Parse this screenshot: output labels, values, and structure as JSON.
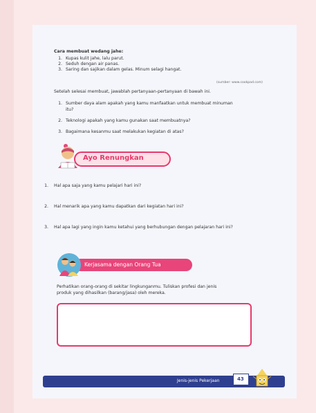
{
  "recipe": {
    "heading": "Cara membuat wedang jahe:",
    "steps": [
      {
        "num": "1.",
        "text": "Kupas kulit jahe, lalu parut."
      },
      {
        "num": "2.",
        "text": "Seduh dengan air panas."
      },
      {
        "num": "3.",
        "text": "Saring dan sajikan dalam gelas. Minum selagi hangat."
      }
    ],
    "source": "(sumber: www.cookpad.com)"
  },
  "questions": {
    "intro": "Setelah selesai membuat, jawablah pertanyaan-pertanyaan di bawah ini.",
    "items": [
      {
        "num": "1.",
        "line1": "Sumber daya alam apakah yang kamu manfaatkan untuk membuat minuman",
        "line2": "itu?"
      },
      {
        "num": "2.",
        "line1": "Teknologi apakah yang kamu gunakan saat membuatnya?"
      },
      {
        "num": "3.",
        "line1": "Bagaimana kesanmu saat melakukan kegiatan di atas?"
      }
    ]
  },
  "reflection": {
    "banner": "Ayo Renungkan",
    "items": [
      {
        "num": "1.",
        "text": "Hal apa saja yang kamu pelajari hari ini?"
      },
      {
        "num": "2.",
        "text": "Hal menarik apa yang kamu dapatkan dari kegiatan hari ini?"
      },
      {
        "num": "3.",
        "text": "Hal apa lagi yang ingin kamu ketahui yang berhubungan dengan pelajaran hari ini?"
      }
    ]
  },
  "family_task": {
    "banner": "Kerjasama dengan Orang Tua",
    "line1": "Perhatikan orang-orang di sekitar lingkunganmu. Tuliskan profesi dan jenis",
    "line2": "produk yang dihasilkan (barang/jasa) oleh mereka."
  },
  "footer": {
    "title": "Jenis-jenis Pekerjaan",
    "page_number": "43"
  },
  "colors": {
    "accent": "#e6396b",
    "footer": "#2f3f8f",
    "background": "#fbe9e9"
  }
}
